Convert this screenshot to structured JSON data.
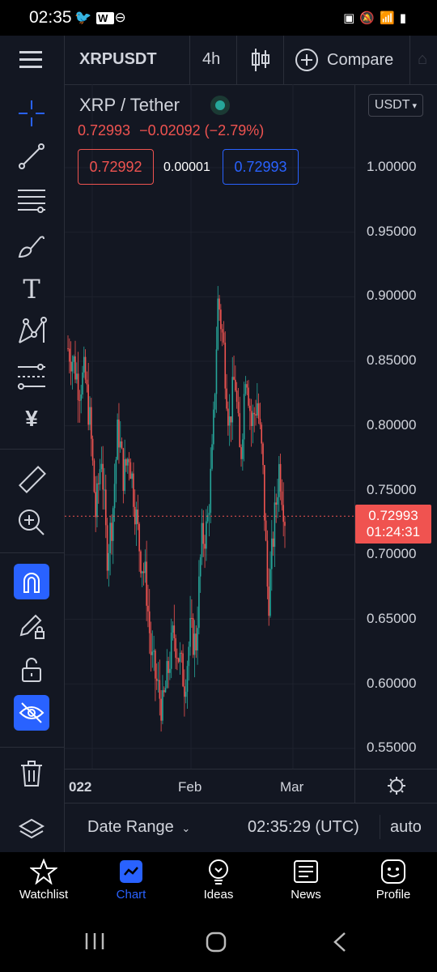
{
  "status_bar": {
    "time": "02:35",
    "left_icons": [
      "twitter-icon",
      "webtoon-icon",
      "dnd-icon"
    ],
    "right_icons": [
      "battery-saver-icon",
      "mute-icon",
      "wifi-icon",
      "signal-icon",
      "battery-icon"
    ]
  },
  "toolbar": {
    "menu_icon": "hamburger-icon",
    "symbol": "XRPUSDT",
    "interval": "4h",
    "chart_type_icon": "candles-icon",
    "compare_label": "Compare"
  },
  "legend": {
    "pair": "XRP / Tether",
    "last_price": "0.72993",
    "change": "−0.02092 (−2.79%)",
    "sell_price": "0.72992",
    "spread": "0.00001",
    "buy_price": "0.72993",
    "currency": "USDT"
  },
  "price_scale": {
    "labels": [
      "1.00000",
      "0.95000",
      "0.90000",
      "0.85000",
      "0.80000",
      "0.75000",
      "0.70000",
      "0.65000",
      "0.60000",
      "0.55000"
    ],
    "current_price": "0.72993",
    "countdown": "01:24:31"
  },
  "time_scale": {
    "labels": [
      "022",
      "Feb",
      "Mar"
    ]
  },
  "bottom_bar": {
    "date_range_label": "Date Range",
    "clock": "02:35:29 (UTC)",
    "scale_mode": "auto"
  },
  "left_tools": [
    "crosshair-icon",
    "trend-line-icon",
    "fib-retracement-icon",
    "brush-icon",
    "text-icon",
    "pattern-icon",
    "prediction-icon",
    "yen-icon",
    "ruler-icon",
    "zoom-in-icon",
    "magnet-icon",
    "lock-drawing-icon",
    "unlock-icon",
    "hide-drawings-icon",
    "trash-icon",
    "layers-icon"
  ],
  "nav": {
    "items": [
      {
        "label": "Watchlist",
        "icon": "star-icon"
      },
      {
        "label": "Chart",
        "icon": "chart-icon"
      },
      {
        "label": "Ideas",
        "icon": "lightbulb-icon"
      },
      {
        "label": "News",
        "icon": "news-icon"
      },
      {
        "label": "Profile",
        "icon": "smiley-icon"
      }
    ]
  },
  "colors": {
    "background": "#131722",
    "up": "#26a69a",
    "down": "#ef5350",
    "accent": "#2962ff",
    "text": "#d1d4dc"
  },
  "chart_data": {
    "type": "candlestick",
    "symbol": "XRPUSDT",
    "interval": "4h",
    "ylim": [
      0.53,
      1.03
    ],
    "price_levels": [
      0.86,
      0.85,
      0.83,
      0.84,
      0.8,
      0.73,
      0.78,
      0.7,
      0.73,
      0.8,
      0.76,
      0.78,
      0.74,
      0.7,
      0.68,
      0.62,
      0.6,
      0.58,
      0.61,
      0.64,
      0.62,
      0.6,
      0.64,
      0.63,
      0.71,
      0.72,
      0.78,
      0.9,
      0.86,
      0.8,
      0.84,
      0.77,
      0.85,
      0.8,
      0.82,
      0.77,
      0.66,
      0.72,
      0.77,
      0.73
    ],
    "current_price": 0.72993
  }
}
